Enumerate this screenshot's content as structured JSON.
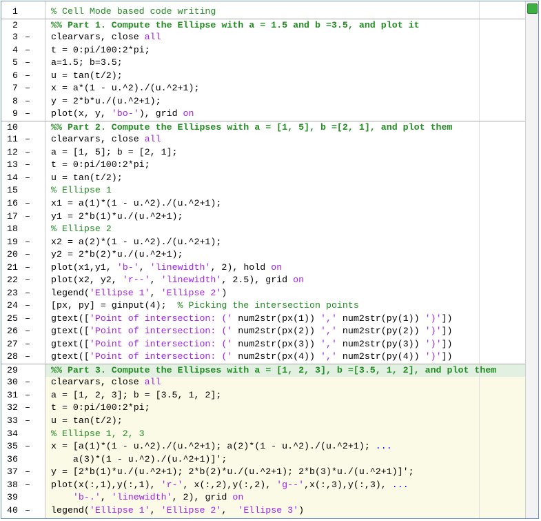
{
  "editor": {
    "lines": [
      {
        "n": "1",
        "mark": "",
        "sep": false,
        "cell": false,
        "tokens": [
          {
            "t": "c",
            "v": "% Cell Mode based code writing"
          }
        ]
      },
      {
        "n": "2",
        "mark": "",
        "sep": true,
        "cell": false,
        "tokens": [
          {
            "t": "ch",
            "v": "%% Part 1. Compute the Ellipse with a = 1.5 and b =3.5, and plot it"
          }
        ]
      },
      {
        "n": "3",
        "mark": "–",
        "sep": false,
        "cell": false,
        "tokens": [
          {
            "t": "p",
            "v": "clearvars, close "
          },
          {
            "t": "s",
            "v": "all"
          }
        ]
      },
      {
        "n": "4",
        "mark": "–",
        "sep": false,
        "cell": false,
        "tokens": [
          {
            "t": "p",
            "v": "t = 0:pi/100:2*pi;"
          }
        ]
      },
      {
        "n": "5",
        "mark": "–",
        "sep": false,
        "cell": false,
        "tokens": [
          {
            "t": "p",
            "v": "a=1.5; b=3.5;"
          }
        ]
      },
      {
        "n": "6",
        "mark": "–",
        "sep": false,
        "cell": false,
        "tokens": [
          {
            "t": "p",
            "v": "u = tan(t/2);"
          }
        ]
      },
      {
        "n": "7",
        "mark": "–",
        "sep": false,
        "cell": false,
        "tokens": [
          {
            "t": "p",
            "v": "x = a*(1 - u.^2)./(u.^2+1);"
          }
        ]
      },
      {
        "n": "8",
        "mark": "–",
        "sep": false,
        "cell": false,
        "tokens": [
          {
            "t": "p",
            "v": "y = 2*b*u./(u.^2+1);"
          }
        ]
      },
      {
        "n": "9",
        "mark": "–",
        "sep": false,
        "cell": false,
        "tokens": [
          {
            "t": "p",
            "v": "plot(x, y, "
          },
          {
            "t": "s",
            "v": "'bo-'"
          },
          {
            "t": "p",
            "v": "), grid "
          },
          {
            "t": "s",
            "v": "on"
          }
        ]
      },
      {
        "n": "10",
        "mark": "",
        "sep": true,
        "cell": false,
        "tokens": [
          {
            "t": "ch",
            "v": "%% Part 2. Compute the Ellipses with a = [1, 5], b =[2, 1], and plot them"
          }
        ]
      },
      {
        "n": "11",
        "mark": "–",
        "sep": false,
        "cell": false,
        "tokens": [
          {
            "t": "p",
            "v": "clearvars, close "
          },
          {
            "t": "s",
            "v": "all"
          }
        ]
      },
      {
        "n": "12",
        "mark": "–",
        "sep": false,
        "cell": false,
        "tokens": [
          {
            "t": "p",
            "v": "a = [1, 5]; b = [2, 1];"
          }
        ]
      },
      {
        "n": "13",
        "mark": "–",
        "sep": false,
        "cell": false,
        "tokens": [
          {
            "t": "p",
            "v": "t = 0:pi/100:2*pi;"
          }
        ]
      },
      {
        "n": "14",
        "mark": "–",
        "sep": false,
        "cell": false,
        "tokens": [
          {
            "t": "p",
            "v": "u = tan(t/2);"
          }
        ]
      },
      {
        "n": "15",
        "mark": "",
        "sep": false,
        "cell": false,
        "tokens": [
          {
            "t": "c",
            "v": "% Ellipse 1"
          }
        ]
      },
      {
        "n": "16",
        "mark": "–",
        "sep": false,
        "cell": false,
        "tokens": [
          {
            "t": "p",
            "v": "x1 = a(1)*(1 - u.^2)./(u.^2+1);"
          }
        ]
      },
      {
        "n": "17",
        "mark": "–",
        "sep": false,
        "cell": false,
        "tokens": [
          {
            "t": "p",
            "v": "y1 = 2*b(1)*u./(u.^2+1);"
          }
        ]
      },
      {
        "n": "18",
        "mark": "",
        "sep": false,
        "cell": false,
        "tokens": [
          {
            "t": "c",
            "v": "% Ellipse 2"
          }
        ]
      },
      {
        "n": "19",
        "mark": "–",
        "sep": false,
        "cell": false,
        "tokens": [
          {
            "t": "p",
            "v": "x2 = a(2)*(1 - u.^2)./(u.^2+1);"
          }
        ]
      },
      {
        "n": "20",
        "mark": "–",
        "sep": false,
        "cell": false,
        "tokens": [
          {
            "t": "p",
            "v": "y2 = 2*b(2)*u./(u.^2+1);"
          }
        ]
      },
      {
        "n": "21",
        "mark": "–",
        "sep": false,
        "cell": false,
        "tokens": [
          {
            "t": "p",
            "v": "plot(x1,y1, "
          },
          {
            "t": "s",
            "v": "'b-'"
          },
          {
            "t": "p",
            "v": ", "
          },
          {
            "t": "s",
            "v": "'linewidth'"
          },
          {
            "t": "p",
            "v": ", 2), hold "
          },
          {
            "t": "s",
            "v": "on"
          }
        ]
      },
      {
        "n": "22",
        "mark": "–",
        "sep": false,
        "cell": false,
        "tokens": [
          {
            "t": "p",
            "v": "plot(x2, y2, "
          },
          {
            "t": "s",
            "v": "'r--'"
          },
          {
            "t": "p",
            "v": ", "
          },
          {
            "t": "s",
            "v": "'linewidth'"
          },
          {
            "t": "p",
            "v": ", 2.5), grid "
          },
          {
            "t": "s",
            "v": "on"
          }
        ]
      },
      {
        "n": "23",
        "mark": "–",
        "sep": false,
        "cell": false,
        "tokens": [
          {
            "t": "p",
            "v": "legend("
          },
          {
            "t": "s",
            "v": "'Ellipse 1'"
          },
          {
            "t": "p",
            "v": ", "
          },
          {
            "t": "s",
            "v": "'Ellipse 2'"
          },
          {
            "t": "p",
            "v": ")"
          }
        ]
      },
      {
        "n": "24",
        "mark": "–",
        "sep": false,
        "cell": false,
        "tokens": [
          {
            "t": "p",
            "v": "[px, py] = ginput(4);  "
          },
          {
            "t": "c",
            "v": "% Picking the intersection points"
          }
        ]
      },
      {
        "n": "25",
        "mark": "–",
        "sep": false,
        "cell": false,
        "tokens": [
          {
            "t": "p",
            "v": "gtext(["
          },
          {
            "t": "s",
            "v": "'Point of intersection: ('"
          },
          {
            "t": "p",
            "v": " num2str(px(1)) "
          },
          {
            "t": "s",
            "v": "','"
          },
          {
            "t": "p",
            "v": " num2str(py(1)) "
          },
          {
            "t": "s",
            "v": "')'"
          },
          {
            "t": "p",
            "v": "])"
          }
        ]
      },
      {
        "n": "26",
        "mark": "–",
        "sep": false,
        "cell": false,
        "tokens": [
          {
            "t": "p",
            "v": "gtext(["
          },
          {
            "t": "s",
            "v": "'Point of intersection: ('"
          },
          {
            "t": "p",
            "v": " num2str(px(2)) "
          },
          {
            "t": "s",
            "v": "','"
          },
          {
            "t": "p",
            "v": " num2str(py(2)) "
          },
          {
            "t": "s",
            "v": "')'"
          },
          {
            "t": "p",
            "v": "])"
          }
        ]
      },
      {
        "n": "27",
        "mark": "–",
        "sep": false,
        "cell": false,
        "tokens": [
          {
            "t": "p",
            "v": "gtext(["
          },
          {
            "t": "s",
            "v": "'Point of intersection: ('"
          },
          {
            "t": "p",
            "v": " num2str(px(3)) "
          },
          {
            "t": "s",
            "v": "','"
          },
          {
            "t": "p",
            "v": " num2str(py(3)) "
          },
          {
            "t": "s",
            "v": "')'"
          },
          {
            "t": "p",
            "v": "])"
          }
        ]
      },
      {
        "n": "28",
        "mark": "–",
        "sep": false,
        "cell": false,
        "tokens": [
          {
            "t": "p",
            "v": "gtext(["
          },
          {
            "t": "s",
            "v": "'Point of intersection: ('"
          },
          {
            "t": "p",
            "v": " num2str(px(4)) "
          },
          {
            "t": "s",
            "v": "','"
          },
          {
            "t": "p",
            "v": " num2str(py(4)) "
          },
          {
            "t": "s",
            "v": "')'"
          },
          {
            "t": "p",
            "v": "])"
          }
        ]
      },
      {
        "n": "29",
        "mark": "",
        "sep": true,
        "cell": true,
        "tokens": [
          {
            "t": "ch",
            "v": "%% Part 3. Compute the Ellipses with a = [1, 2, 3], b =[3.5, 1, 2], and plot them"
          }
        ]
      },
      {
        "n": "30",
        "mark": "–",
        "sep": false,
        "cell": true,
        "tokens": [
          {
            "t": "p",
            "v": "clearvars, close "
          },
          {
            "t": "s",
            "v": "all"
          }
        ]
      },
      {
        "n": "31",
        "mark": "–",
        "sep": false,
        "cell": true,
        "tokens": [
          {
            "t": "p",
            "v": "a = [1, 2, 3]; b = [3.5, 1, 2];"
          }
        ]
      },
      {
        "n": "32",
        "mark": "–",
        "sep": false,
        "cell": true,
        "tokens": [
          {
            "t": "p",
            "v": "t = 0:pi/100:2*pi;"
          }
        ]
      },
      {
        "n": "33",
        "mark": "–",
        "sep": false,
        "cell": true,
        "tokens": [
          {
            "t": "p",
            "v": "u = tan(t/2);"
          }
        ]
      },
      {
        "n": "34",
        "mark": "",
        "sep": false,
        "cell": true,
        "tokens": [
          {
            "t": "c",
            "v": "% Ellipse 1, 2, 3"
          }
        ]
      },
      {
        "n": "35",
        "mark": "–",
        "sep": false,
        "cell": true,
        "tokens": [
          {
            "t": "p",
            "v": "x = [a(1)*(1 - u.^2)./(u.^2+1); a(2)*(1 - u.^2)./(u.^2+1); "
          },
          {
            "t": "k",
            "v": "..."
          }
        ]
      },
      {
        "n": "36",
        "mark": "",
        "sep": false,
        "cell": true,
        "tokens": [
          {
            "t": "p",
            "v": "    a(3)*(1 - u.^2)./(u.^2+1)]';"
          }
        ]
      },
      {
        "n": "37",
        "mark": "–",
        "sep": false,
        "cell": true,
        "tokens": [
          {
            "t": "p",
            "v": "y = [2*b(1)*u./(u.^2+1); 2*b(2)*u./(u.^2+1); 2*b(3)*u./(u.^2+1)]';"
          }
        ]
      },
      {
        "n": "38",
        "mark": "–",
        "sep": false,
        "cell": true,
        "tokens": [
          {
            "t": "p",
            "v": "plot(x(:,1),y(:,1), "
          },
          {
            "t": "s",
            "v": "'r-'"
          },
          {
            "t": "p",
            "v": ", x(:,2),y(:,2), "
          },
          {
            "t": "s",
            "v": "'g--'"
          },
          {
            "t": "p",
            "v": ",x(:,3),y(:,3), "
          },
          {
            "t": "k",
            "v": "..."
          }
        ]
      },
      {
        "n": "39",
        "mark": "",
        "sep": false,
        "cell": true,
        "tokens": [
          {
            "t": "p",
            "v": "    "
          },
          {
            "t": "s",
            "v": "'b-.'"
          },
          {
            "t": "p",
            "v": ", "
          },
          {
            "t": "s",
            "v": "'linewidth'"
          },
          {
            "t": "p",
            "v": ", 2), grid "
          },
          {
            "t": "s",
            "v": "on"
          }
        ]
      },
      {
        "n": "40",
        "mark": "–",
        "sep": false,
        "cell": true,
        "tokens": [
          {
            "t": "p",
            "v": "legend("
          },
          {
            "t": "s",
            "v": "'Ellipse 1'"
          },
          {
            "t": "p",
            "v": ", "
          },
          {
            "t": "s",
            "v": "'Ellipse 2'"
          },
          {
            "t": "p",
            "v": ",  "
          },
          {
            "t": "s",
            "v": "'Ellipse 3'"
          },
          {
            "t": "p",
            "v": ")"
          }
        ]
      }
    ]
  },
  "colors": {
    "comment": "#228b22",
    "string": "#a020f0",
    "keyword": "#0000ff",
    "active_cell_bg": "#fafae6",
    "status_indicator": "#3cb043"
  }
}
